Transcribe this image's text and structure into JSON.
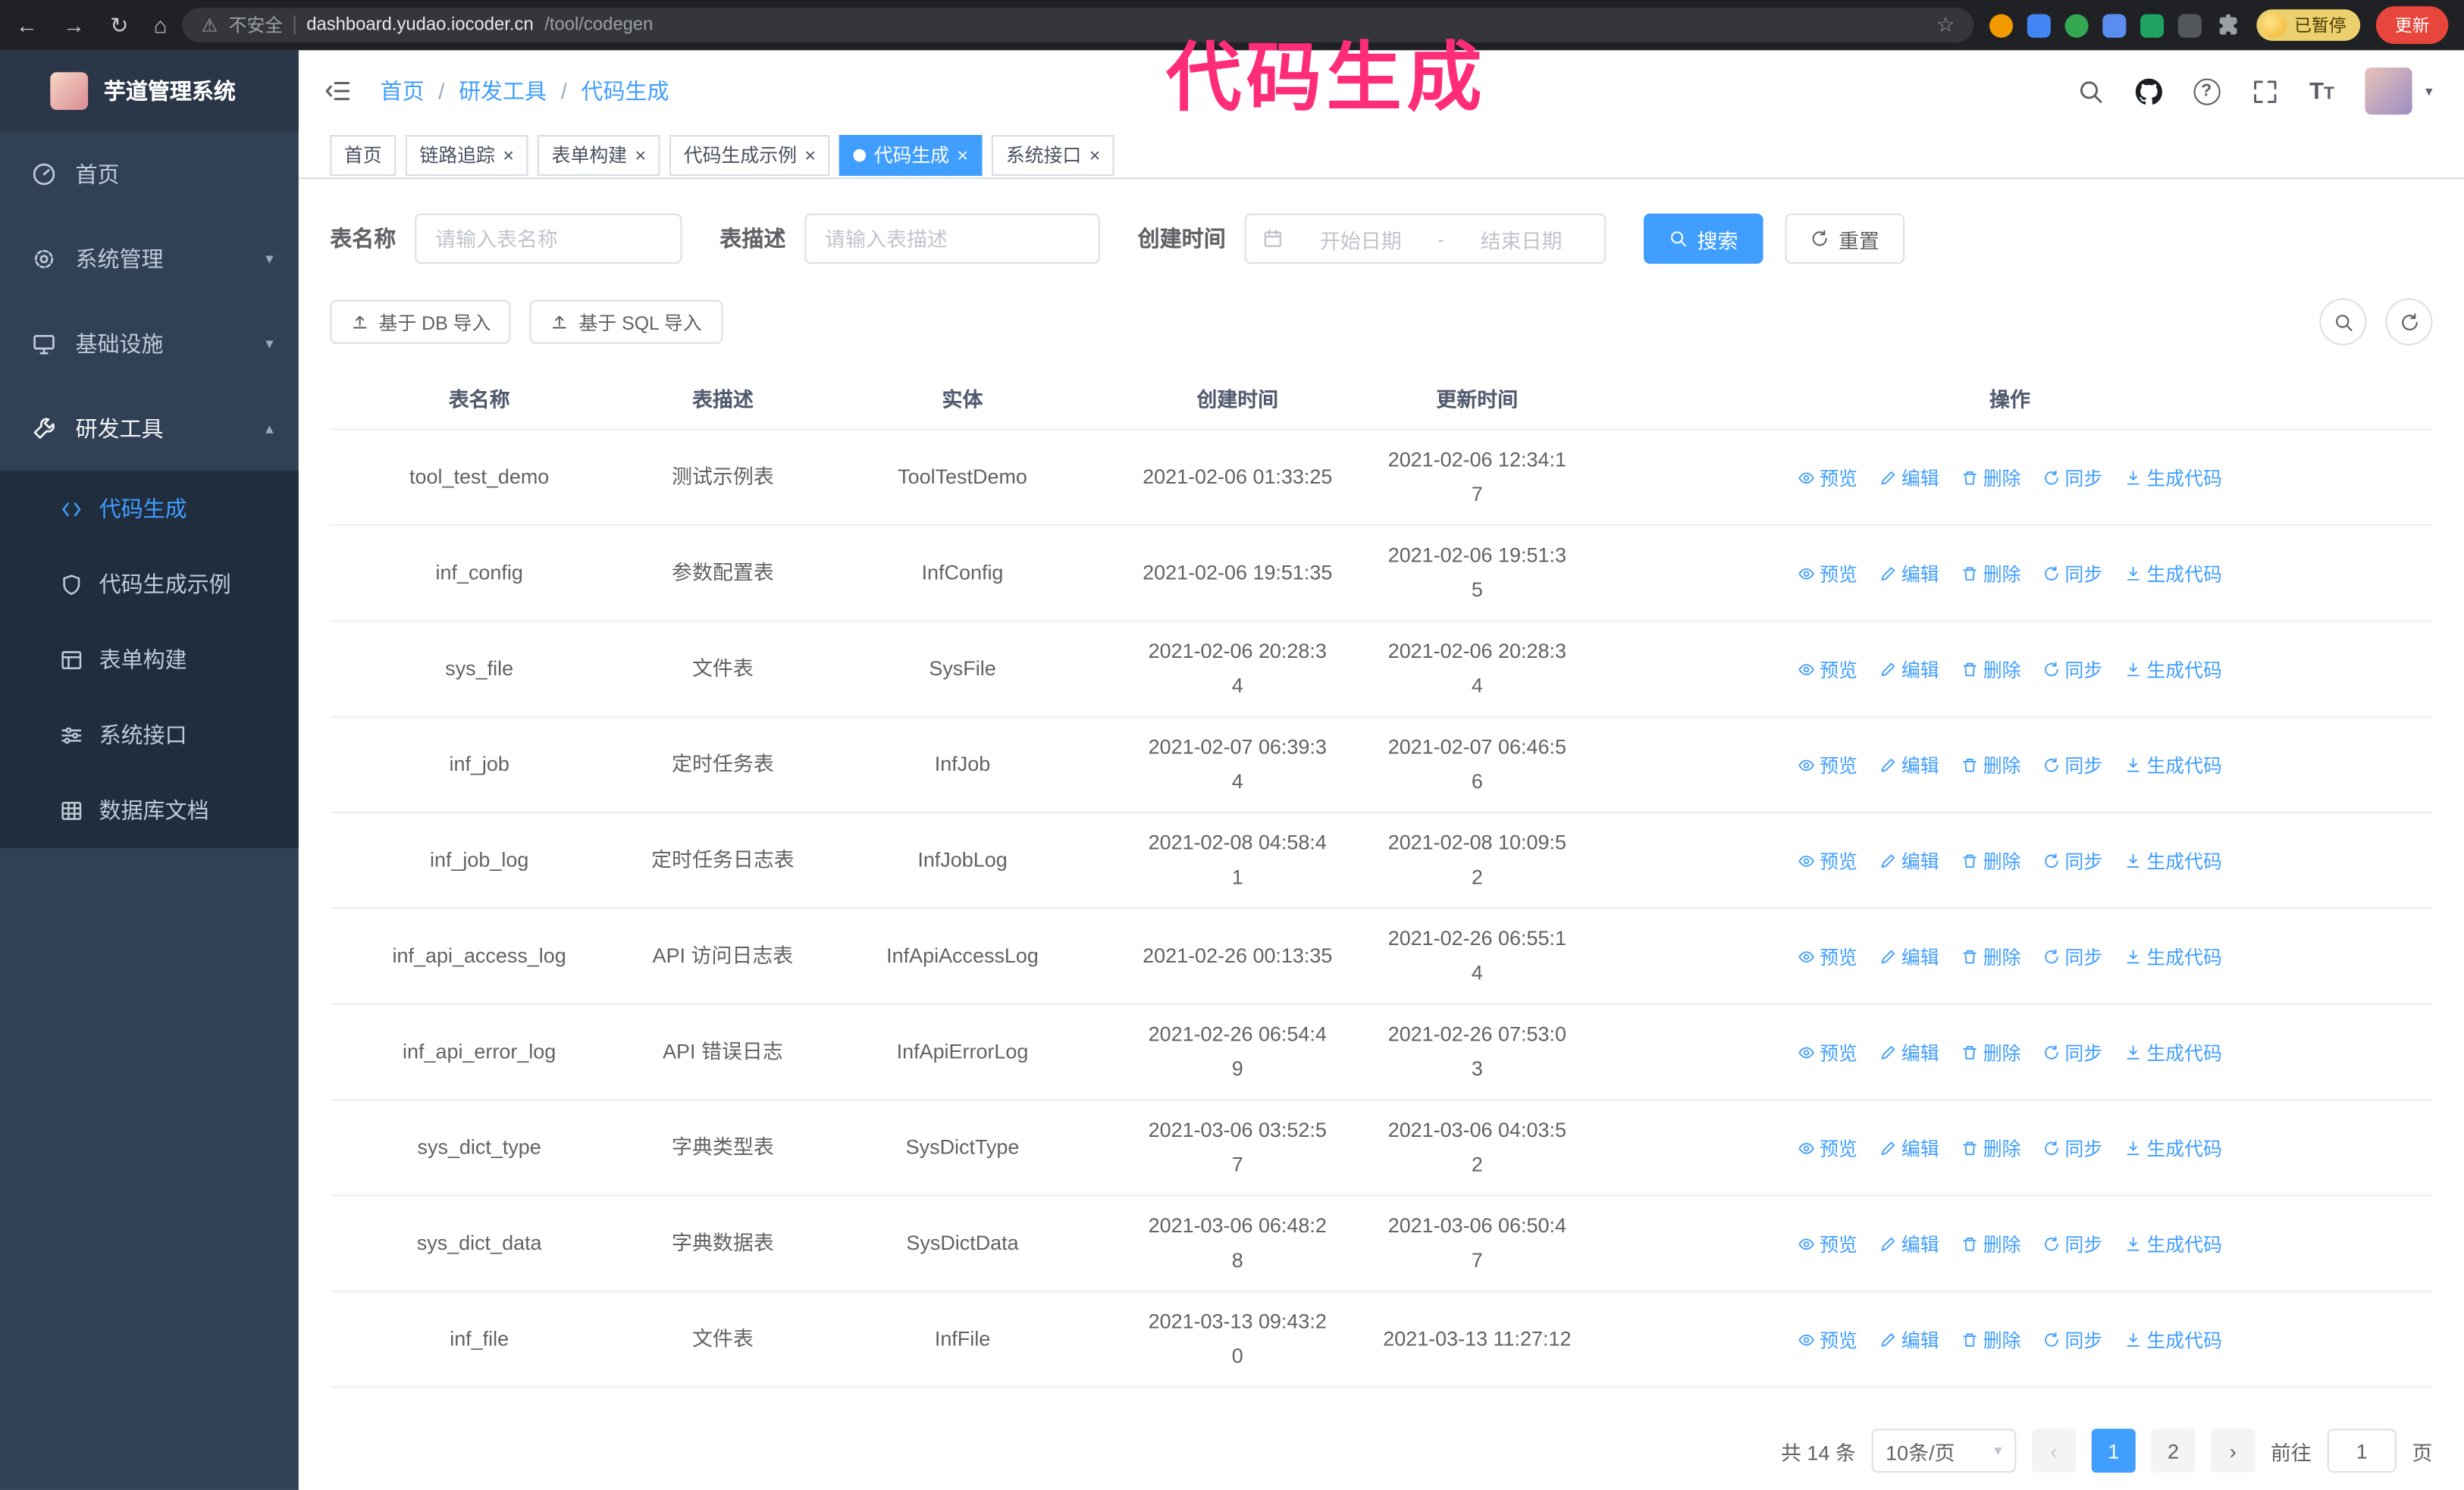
{
  "annotation": {
    "text": "代码生成",
    "color": "#ff2d78"
  },
  "icons": {
    "back": "←",
    "forward": "→",
    "reload": "↻",
    "home": "⌂",
    "warning": "⚠",
    "star": "☆",
    "close": "×",
    "caret_down": "▾",
    "caret_up": "▴",
    "question": "?",
    "letter_t": "T",
    "pager_prev": "‹",
    "pager_next": "›"
  },
  "browser": {
    "security_label": "不安全",
    "url_host": "dashboard.yudao.iocoder.cn",
    "url_path": "/tool/codegen",
    "profile_chip": "已暂停",
    "update_button": "更新"
  },
  "sidebar": {
    "logo_title": "芋道管理系统",
    "items": [
      {
        "label": "首页"
      },
      {
        "label": "系统管理"
      },
      {
        "label": "基础设施"
      },
      {
        "label": "研发工具"
      }
    ],
    "subitems": [
      {
        "label": "代码生成"
      },
      {
        "label": "代码生成示例"
      },
      {
        "label": "表单构建"
      },
      {
        "label": "系统接口"
      },
      {
        "label": "数据库文档"
      }
    ]
  },
  "header": {
    "breadcrumb": [
      "首页",
      "研发工具",
      "代码生成"
    ],
    "breadcrumb_separator": "/"
  },
  "tabs": [
    {
      "label": "首页",
      "closable": false,
      "active": false
    },
    {
      "label": "链路追踪",
      "closable": true,
      "active": false
    },
    {
      "label": "表单构建",
      "closable": true,
      "active": false
    },
    {
      "label": "代码生成示例",
      "closable": true,
      "active": false
    },
    {
      "label": "代码生成",
      "closable": true,
      "active": true
    },
    {
      "label": "系统接口",
      "closable": true,
      "active": false
    }
  ],
  "filters": {
    "table_name_label": "表名称",
    "table_name_placeholder": "请输入表名称",
    "table_desc_label": "表描述",
    "table_desc_placeholder": "请输入表描述",
    "create_time_label": "创建时间",
    "date_start_placeholder": "开始日期",
    "date_separator": "-",
    "date_end_placeholder": "结束日期",
    "search_button": "搜索",
    "reset_button": "重置"
  },
  "toolbar": {
    "import_db": "基于 DB 导入",
    "import_sql": "基于 SQL 导入"
  },
  "table": {
    "columns": [
      "表名称",
      "表描述",
      "实体",
      "创建时间",
      "更新时间",
      "操作"
    ],
    "actions": [
      "预览",
      "编辑",
      "删除",
      "同步",
      "生成代码"
    ],
    "rows": [
      {
        "name": "tool_test_demo",
        "desc": "测试示例表",
        "entity": "ToolTestDemo",
        "created": "2021-02-06 01:33:25",
        "updated": "2021-02-06 12:34:17"
      },
      {
        "name": "inf_config",
        "desc": "参数配置表",
        "entity": "InfConfig",
        "created": "2021-02-06 19:51:35",
        "updated": "2021-02-06 19:51:35"
      },
      {
        "name": "sys_file",
        "desc": "文件表",
        "entity": "SysFile",
        "created": "2021-02-06 20:28:3\n4",
        "updated": "2021-02-06 20:28:3\n4"
      },
      {
        "name": "inf_job",
        "desc": "定时任务表",
        "entity": "InfJob",
        "created": "2021-02-07 06:39:3\n4",
        "updated": "2021-02-07 06:46:5\n6"
      },
      {
        "name": "inf_job_log",
        "desc": "定时任务日志表",
        "entity": "InfJobLog",
        "created": "2021-02-08 04:58:4\n1",
        "updated": "2021-02-08 10:09:5\n2"
      },
      {
        "name": "inf_api_access_log",
        "desc": "API 访问日志表",
        "entity": "InfApiAccessLog",
        "created": "2021-02-26 00:13:35",
        "updated": "2021-02-26 06:55:1\n4"
      },
      {
        "name": "inf_api_error_log",
        "desc": "API 错误日志",
        "entity": "InfApiErrorLog",
        "created": "2021-02-26 06:54:4\n9",
        "updated": "2021-02-26 07:53:0\n3"
      },
      {
        "name": "sys_dict_type",
        "desc": "字典类型表",
        "entity": "SysDictType",
        "created": "2021-03-06 03:52:5\n7",
        "updated": "2021-03-06 04:03:5\n2"
      },
      {
        "name": "sys_dict_data",
        "desc": "字典数据表",
        "entity": "SysDictData",
        "created": "2021-03-06 06:48:2\n8",
        "updated": "2021-03-06 06:50:4\n7"
      },
      {
        "name": "inf_file",
        "desc": "文件表",
        "entity": "InfFile",
        "created": "2021-03-13 09:43:2\n0",
        "updated": "2021-03-13 11:27:12"
      }
    ]
  },
  "pagination": {
    "total": "共 14 条",
    "page_size": "10条/页",
    "pages": [
      "1",
      "2"
    ],
    "goto_label": "前往",
    "goto_value": "1",
    "goto_suffix": "页"
  }
}
